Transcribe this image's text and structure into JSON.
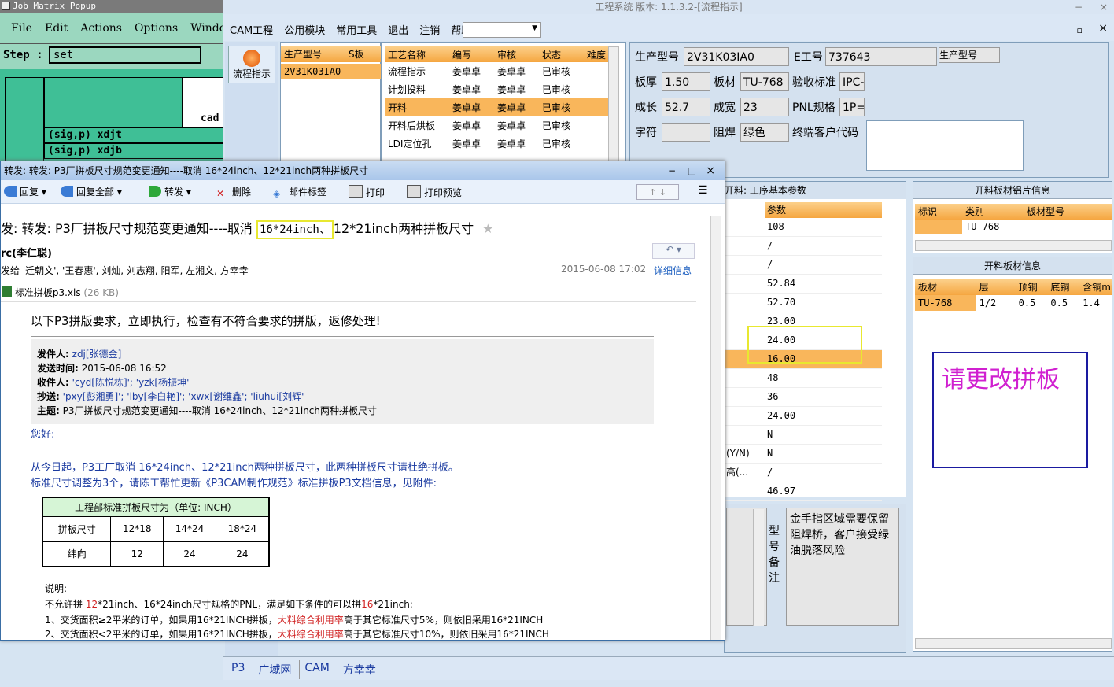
{
  "job_matrix": {
    "title": "Job Matrix Popup",
    "menu": [
      "File",
      "Edit",
      "Actions",
      "Options",
      "Windows"
    ],
    "step_label": "Step :",
    "step_value": "set",
    "cells": [
      "cad",
      "(sig,p) xdjt",
      "(sig,p) xdjb"
    ]
  },
  "app": {
    "title": "工程系统 版本: 1.1.3.2-[流程指示]",
    "menu": [
      "CAM工程",
      "公用模块",
      "常用工具",
      "退出",
      "注销",
      "帮助"
    ],
    "flow_button": "流程指示"
  },
  "model_list": {
    "headers": [
      "生产型号",
      "S板"
    ],
    "rows": [
      "2V31K03IA0"
    ]
  },
  "process_table": {
    "headers": [
      "工艺名称",
      "编写",
      "审核",
      "状态",
      "难度"
    ],
    "rows": [
      [
        "流程指示",
        "姜卓卓",
        "姜卓卓",
        "已审核",
        ""
      ],
      [
        "计划投料",
        "姜卓卓",
        "姜卓卓",
        "已审核",
        ""
      ],
      [
        "开料",
        "姜卓卓",
        "姜卓卓",
        "已审核",
        ""
      ],
      [
        "开料后烘板",
        "姜卓卓",
        "姜卓卓",
        "已审核",
        ""
      ],
      [
        "LDI定位孔",
        "姜卓卓",
        "姜卓卓",
        "已审核",
        ""
      ]
    ]
  },
  "info": {
    "prod_model_label": "生产型号",
    "prod_model": "2V31K03IA0",
    "e_no_label": "E工号",
    "e_no": "737643",
    "prod_model2_label": "生产型号",
    "thickness_label": "板厚",
    "thickness": "1.50",
    "material_label": "板材",
    "material": "TU-768",
    "accept_label": "验收标准",
    "accept": "IPC-",
    "length_label": "成长",
    "length": "52.7",
    "width_label": "成宽",
    "width": "23",
    "pnl_label": "PNL规格",
    "pnl": "1P=",
    "char_label": "字符",
    "char": "",
    "mask_label": "阻焊",
    "mask": "绿色",
    "cust_label": "终端客户代码"
  },
  "params": {
    "title": "开料: 工序基本参数",
    "header": "参数",
    "labels": [
      "",
      "",
      "",
      "",
      "",
      "",
      "",
      "",
      "",
      "",
      "",
      "",
      "(Y/N)",
      "高(...",
      ""
    ],
    "values": [
      "108",
      "/",
      "/",
      "52.84",
      "52.70",
      "23.00",
      "24.00",
      "16.00",
      "48",
      "36",
      "24.00",
      "N",
      "N",
      "/",
      "46.97"
    ]
  },
  "alu_sheet": {
    "title": "开料板材铝片信息",
    "headers": [
      "标识",
      "类别",
      "板材型号"
    ],
    "row": [
      "",
      "TU-768",
      ""
    ]
  },
  "board_info": {
    "title": "开料板材信息",
    "headers": [
      "板材",
      "层",
      "顶铜",
      "底铜",
      "含铜mm"
    ],
    "row": [
      "TU-768",
      "1/2",
      "0.5",
      "0.5",
      "1.4"
    ]
  },
  "note_box": "请更改拼板",
  "remarks": {
    "label": "型号备注",
    "text": "金手指区域需要保留阻焊桥，客户接受绿油脱落风险"
  },
  "bottom": [
    "P3",
    "广域网",
    "CAM",
    "方幸幸"
  ],
  "mail": {
    "window_title": "转发: 转发: P3厂拼板尺寸规范变更通知----取消 16*24inch、12*21inch两种拼板尺寸",
    "toolbar": [
      "回复",
      "回复全部",
      "转发",
      "删除",
      "邮件标签",
      "打印",
      "打印预览"
    ],
    "subject_prefix": "发: 转发: P3厂拼板尺寸规范变更通知----取消 ",
    "subject_highlight": "16*24inch、",
    "subject_suffix": "12*21inch两种拼板尺寸",
    "sender": "rc(李仁聪)",
    "recipients": "发给 '迁朝文', '王春惠', 刘灿, 刘志翔, 阳军, 左湘文, 方幸幸",
    "date": "2015-06-08 17:02",
    "detail_link": "详细信息",
    "attachment": "标准拼板p3.xls",
    "attachment_size": "(26 KB)",
    "intro": "以下P3拼版要求，立即执行，检查有不符合要求的拼版，返修处理!",
    "fwd": {
      "from_label": "发件人:",
      "from": "zdj[张德金]",
      "time_label": "发送时间:",
      "time": "2015-06-08 16:52",
      "to_label": "收件人:",
      "to": "'cyd[陈悦栋]'; 'yzk[杨振坤'",
      "cc_label": "抄送:",
      "cc": "'pxy[彭湘勇]'; 'lby[李白艳]'; 'xwx[谢维鑫'; 'liuhui[刘辉'",
      "subj_label": "主题:",
      "subj": "P3厂拼板尺寸规范变更通知----取消 16*24inch、12*21inch两种拼板尺寸"
    },
    "greeting": "您好:",
    "body1": "从今日起，P3工厂取消 16*24inch、12*21inch两种拼板尺寸，此两种拼板尺寸请杜绝拼板。",
    "body2": "标准尺寸调整为3个，请陈工帮忙更新《P3CAM制作规范》标准拼板P3文档信息，见附件:",
    "std_table": {
      "title": "工程部标准拼板尺寸为（单位: INCH）",
      "row1": [
        "拼板尺寸",
        "12*18",
        "14*24",
        "18*24"
      ],
      "row2": [
        "纬向",
        "12",
        "24",
        "24"
      ]
    },
    "note_title": "说明:",
    "note1_pre": "不允许拼 ",
    "note1_red": "12",
    "note1_mid": "*21inch、16*24inch尺寸规格的PNL，满足如下条件的可以拼",
    "note1_red2": "16",
    "note1_post": "*21inch:",
    "note2_pre": "1、交货面积≥2平米的订单，如果用16*21INCH拼板，",
    "note2_red": "大料综合利用率",
    "note2_post": "高于其它标准尺寸5%，则依旧采用16*21INCH",
    "note3_pre": "2、交货面积<2平米的订单，如果用16*21INCH拼板，",
    "note3_red": "大料综合利用率",
    "note3_post": "高于其它标准尺寸10%，则依旧采用16*21INCH"
  }
}
